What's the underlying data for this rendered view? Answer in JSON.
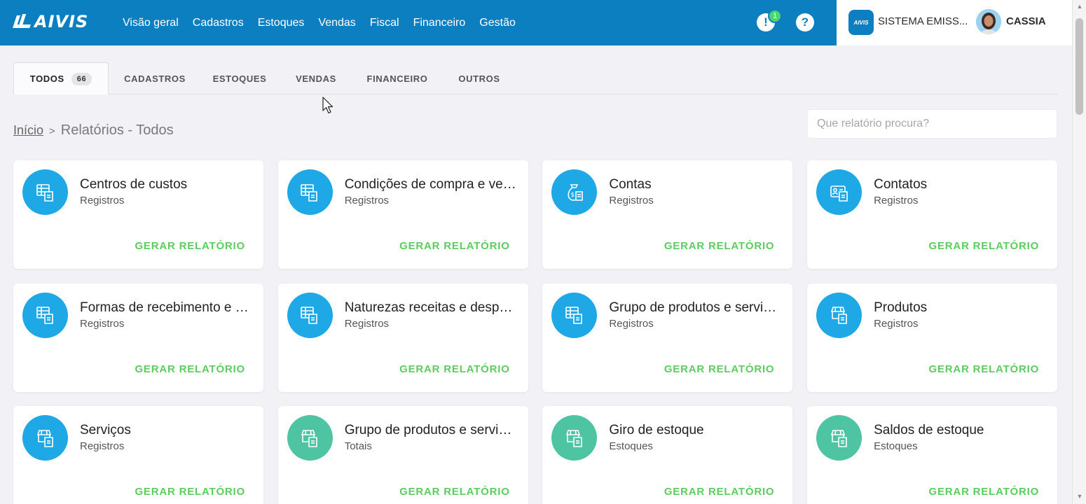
{
  "header": {
    "logo_text": "AIVIS",
    "nav": [
      "Visão geral",
      "Cadastros",
      "Estoques",
      "Vendas",
      "Fiscal",
      "Financeiro",
      "Gestão"
    ],
    "notification_icon": "alert-icon",
    "notification_count": "1",
    "help_icon": "help-icon",
    "company_logo_text": "AIVIS",
    "company_name": "SISTEMA EMISS...",
    "user_name": "CASSIA"
  },
  "tabs": [
    {
      "label": "TODOS",
      "count": "66",
      "active": true
    },
    {
      "label": "CADASTROS"
    },
    {
      "label": "ESTOQUES"
    },
    {
      "label": "VENDAS"
    },
    {
      "label": "FINANCEIRO"
    },
    {
      "label": "OUTROS"
    }
  ],
  "breadcrumb": {
    "home": "Início",
    "separator": ">",
    "current": "Relatórios - Todos"
  },
  "search": {
    "placeholder": "Que relatório procura?",
    "value": ""
  },
  "cards": [
    {
      "title": "Centros de custos",
      "subtitle": "Registros",
      "icon": "table-report-icon",
      "color": "#1ea8e5"
    },
    {
      "title": "Condições de compra e venda",
      "subtitle": "Registros",
      "icon": "table-report-icon",
      "color": "#1ea8e5"
    },
    {
      "title": "Contas",
      "subtitle": "Registros",
      "icon": "money-bag-icon",
      "color": "#1ea8e5"
    },
    {
      "title": "Contatos",
      "subtitle": "Registros",
      "icon": "contact-card-icon",
      "color": "#1ea8e5"
    },
    {
      "title": "Formas de recebimento e pagamento",
      "subtitle": "Registros",
      "icon": "table-report-icon",
      "color": "#1ea8e5"
    },
    {
      "title": "Naturezas receitas e despesas",
      "subtitle": "Registros",
      "icon": "table-report-icon",
      "color": "#1ea8e5"
    },
    {
      "title": "Grupo de produtos e serviços",
      "subtitle": "Registros",
      "icon": "table-report-icon",
      "color": "#1ea8e5"
    },
    {
      "title": "Produtos",
      "subtitle": "Registros",
      "icon": "store-report-icon",
      "color": "#1ea8e5"
    },
    {
      "title": "Serviços",
      "subtitle": "Registros",
      "icon": "store-report-icon",
      "color": "#1ea8e5"
    },
    {
      "title": "Grupo de produtos e serviços",
      "subtitle": "Totais",
      "icon": "store-report-icon",
      "color": "#4ec4a2"
    },
    {
      "title": "Giro de estoque",
      "subtitle": "Estoques",
      "icon": "store-report-icon",
      "color": "#4ec4a2"
    },
    {
      "title": "Saldos de estoque",
      "subtitle": "Estoques",
      "icon": "store-report-icon",
      "color": "#4ec4a2"
    }
  ],
  "card_action_label": "GERAR RELATÓRIO",
  "colors": {
    "header_bg": "#0c7fc0",
    "accent_blue": "#1ea8e5",
    "accent_teal": "#4ec4a2",
    "action_green": "#5ccc60",
    "badge_green": "#4cd46f"
  }
}
